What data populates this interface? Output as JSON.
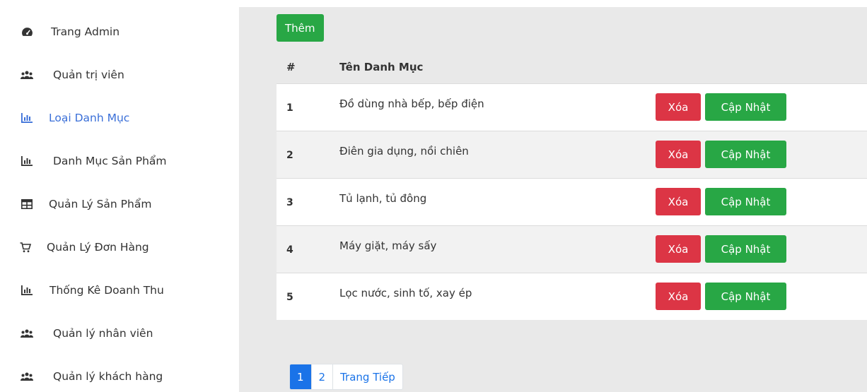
{
  "sidebar": {
    "active_color": "#3a6fd8",
    "items": [
      {
        "label": "Trang Admin",
        "icon": "dashboard-icon",
        "active": false
      },
      {
        "label": "Quản trị viên",
        "icon": "users-icon",
        "active": false
      },
      {
        "label": "Loại Danh Mục",
        "icon": "bar-chart-icon",
        "active": true
      },
      {
        "label": "Danh Mục Sản Phẩm",
        "icon": "bar-chart-icon",
        "active": false
      },
      {
        "label": "Quản Lý Sản Phẩm",
        "icon": "table-icon",
        "active": false
      },
      {
        "label": "Quản Lý Đơn Hàng",
        "icon": "cart-icon",
        "active": false
      },
      {
        "label": "Thống Kê Doanh Thu",
        "icon": "bar-chart-icon",
        "active": false
      },
      {
        "label": "Quản lý nhân viên",
        "icon": "users-icon",
        "active": false
      },
      {
        "label": "Quản lý khách hàng",
        "icon": "users-icon",
        "active": false
      }
    ]
  },
  "main": {
    "add_label": "Thêm",
    "table": {
      "headers": [
        "#",
        "Tên Danh Mục"
      ],
      "rows": [
        {
          "num": "1",
          "name": "Đồ dùng nhà bếp, bếp điện"
        },
        {
          "num": "2",
          "name": "Điên gia dụng, nồi chiên"
        },
        {
          "num": "3",
          "name": "Tủ lạnh, tủ đông"
        },
        {
          "num": "4",
          "name": "Máy giặt, máy sấy"
        },
        {
          "num": "5",
          "name": "Lọc nước, sinh tố, xay ép"
        }
      ],
      "delete_label": "Xóa",
      "update_label": "Cập Nhật"
    },
    "pagination": {
      "pages": [
        "1",
        "2"
      ],
      "active_page": "1",
      "next_label": "Trang Tiếp"
    }
  },
  "colors": {
    "green": "#28a745",
    "red": "#dc3545",
    "blue": "#1a73e8",
    "panel_bg": "#e9e9e9"
  }
}
